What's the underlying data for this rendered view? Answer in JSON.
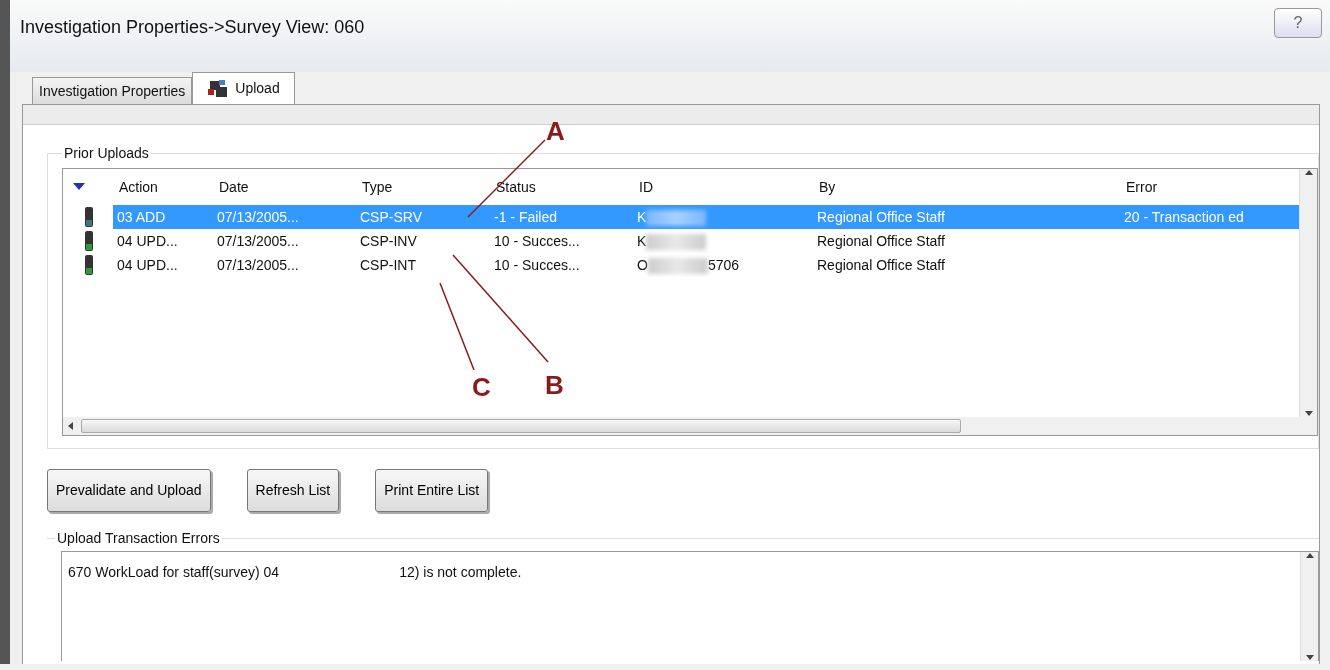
{
  "window": {
    "title": "Investigation Properties->Survey View: 060",
    "help_button": "?"
  },
  "tabs": [
    {
      "label": "Investigation Properties",
      "selected": false,
      "icon": false
    },
    {
      "label": "Upload",
      "selected": true,
      "icon": true
    }
  ],
  "prior_uploads": {
    "title": "Prior Uploads",
    "columns": [
      "Action",
      "Date",
      "Type",
      "Status",
      "ID",
      "By",
      "Error"
    ],
    "rows": [
      {
        "selected": true,
        "color": "#3f7480",
        "cells": [
          "03 ADD",
          "07/13/2005...",
          "CSP-SRV",
          "-1 - Failed",
          "K",
          "Regional Office Staff",
          "20  - Transaction ed"
        ],
        "id_tail": ""
      },
      {
        "selected": false,
        "color": "#2f9a35",
        "cells": [
          "04 UPD...",
          "07/13/2005...",
          "CSP-INV",
          "10 - Succes...",
          "K",
          "Regional Office Staff",
          ""
        ],
        "id_tail": ""
      },
      {
        "selected": false,
        "color": "#2f9a35",
        "cells": [
          "04 UPD...",
          "07/13/2005...",
          "CSP-INT",
          "10 - Succes...",
          "O",
          "Regional Office Staff",
          ""
        ],
        "id_tail": "5706"
      }
    ],
    "buttons": [
      "Prevalidate and Upload",
      "Refresh List",
      "Print Entire List"
    ]
  },
  "annotations": [
    {
      "label": "A"
    },
    {
      "label": "B"
    },
    {
      "label": "C"
    }
  ],
  "upload_errors": {
    "title": "Upload Transaction Errors",
    "lines": [
      {
        "start": "670 WorkLoad for staff(survey) 04",
        "end": "12) is not complete."
      }
    ]
  }
}
